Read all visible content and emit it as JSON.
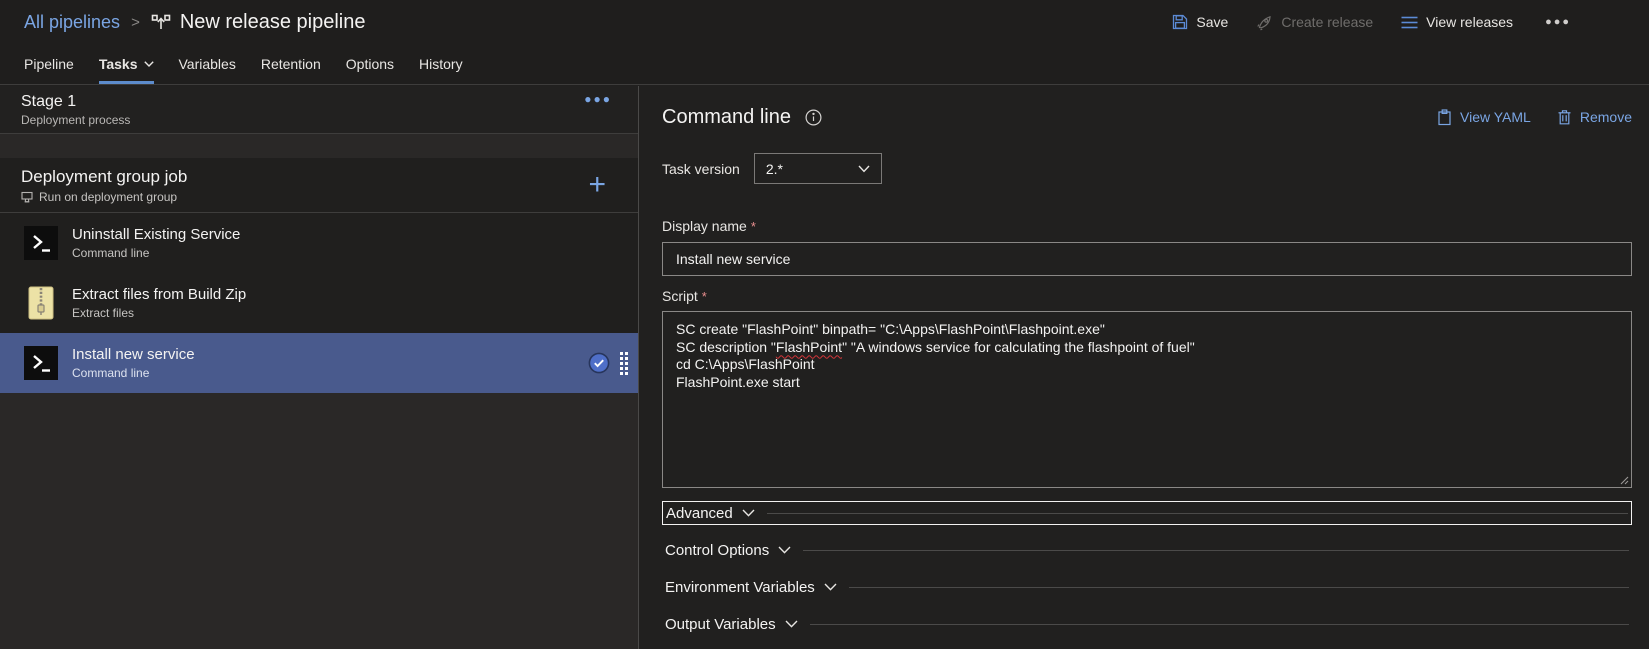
{
  "breadcrumb": {
    "root": "All pipelines",
    "separator": ">",
    "title": "New release pipeline"
  },
  "toolbar": {
    "save": "Save",
    "create_release": "Create release",
    "view_releases": "View releases",
    "more": "●●●"
  },
  "tabs": {
    "items": [
      {
        "label": "Pipeline"
      },
      {
        "label": "Tasks"
      },
      {
        "label": "Variables"
      },
      {
        "label": "Retention"
      },
      {
        "label": "Options"
      },
      {
        "label": "History"
      }
    ],
    "selected": "Tasks"
  },
  "stage": {
    "title": "Stage 1",
    "subtitle": "Deployment process",
    "more": "●●●"
  },
  "job": {
    "title": "Deployment group job",
    "subtitle": "Run on deployment group",
    "add": "+"
  },
  "tasks": [
    {
      "title": "Uninstall Existing Service",
      "type": "Command line",
      "icon": "terminal"
    },
    {
      "title": "Extract files from Build Zip",
      "type": "Extract files",
      "icon": "zip"
    },
    {
      "title": "Install new service",
      "type": "Command line",
      "icon": "terminal",
      "selected": true
    }
  ],
  "panel": {
    "title": "Command line",
    "view_yaml": "View YAML",
    "remove": "Remove",
    "task_version": {
      "label": "Task version",
      "value": "2.*"
    },
    "display_name": {
      "label": "Display name",
      "required": "*",
      "value": "Install new service"
    },
    "script": {
      "label": "Script",
      "required": "*",
      "line1": "SC create \"FlashPoint\" binpath= \"C:\\Apps\\FlashPoint\\Flashpoint.exe\"",
      "line2_prefix": "SC description \"",
      "line2_misspelled": "FlashPoint",
      "line2_suffix": "\" \"A windows service for calculating the flashpoint of fuel\"",
      "line3": "cd C:\\Apps\\FlashPoint",
      "line4": "FlashPoint.exe start"
    },
    "sections": [
      {
        "label": "Advanced"
      },
      {
        "label": "Control Options"
      },
      {
        "label": "Environment Variables"
      },
      {
        "label": "Output Variables"
      }
    ]
  },
  "colors": {
    "accent_link": "#7aa5e3",
    "icon_blue": "#5c8bd6",
    "tab_underline": "#5d8ccc",
    "selected_row": "#495a8d",
    "required_red": "#e98f8f",
    "squiggle_red": "#d13438"
  }
}
